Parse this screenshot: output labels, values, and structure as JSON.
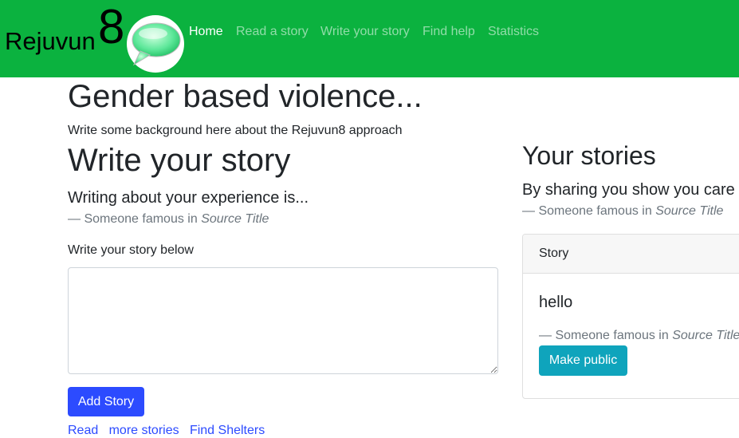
{
  "brand": {
    "name": "Rejuvun",
    "number": "8",
    "logo_icon": "speech-bubble-icon"
  },
  "nav": {
    "items": [
      {
        "label": "Home",
        "active": true
      },
      {
        "label": "Read a story",
        "active": false
      },
      {
        "label": "Write your story",
        "active": false
      },
      {
        "label": "Find help",
        "active": false
      },
      {
        "label": "Statistics",
        "active": false
      }
    ]
  },
  "main": {
    "heading": "Gender based violence...",
    "intro": "Write some background here about the Rejuvun8 approach",
    "write": {
      "heading": "Write your story",
      "quote": "Writing about your experience is...",
      "quote_author": "— Someone famous in ",
      "quote_source": "Source Title",
      "textarea_label": "Write your story below",
      "textarea_value": "",
      "add_button": "Add Story",
      "links": "Read   more stories   Find Shelters"
    }
  },
  "stories": {
    "heading": "Your stories",
    "quote": "By sharing you show you care",
    "quote_author": "— Someone famous in ",
    "quote_source": "Source Title",
    "card": {
      "header": "Story",
      "text": "hello",
      "foot_author": "— Someone famous in ",
      "foot_source": "Source Title",
      "button": "Make public"
    }
  },
  "colors": {
    "navbar": "#0bb23f",
    "primary": "#2c4bff",
    "info": "#0fa4bc"
  }
}
